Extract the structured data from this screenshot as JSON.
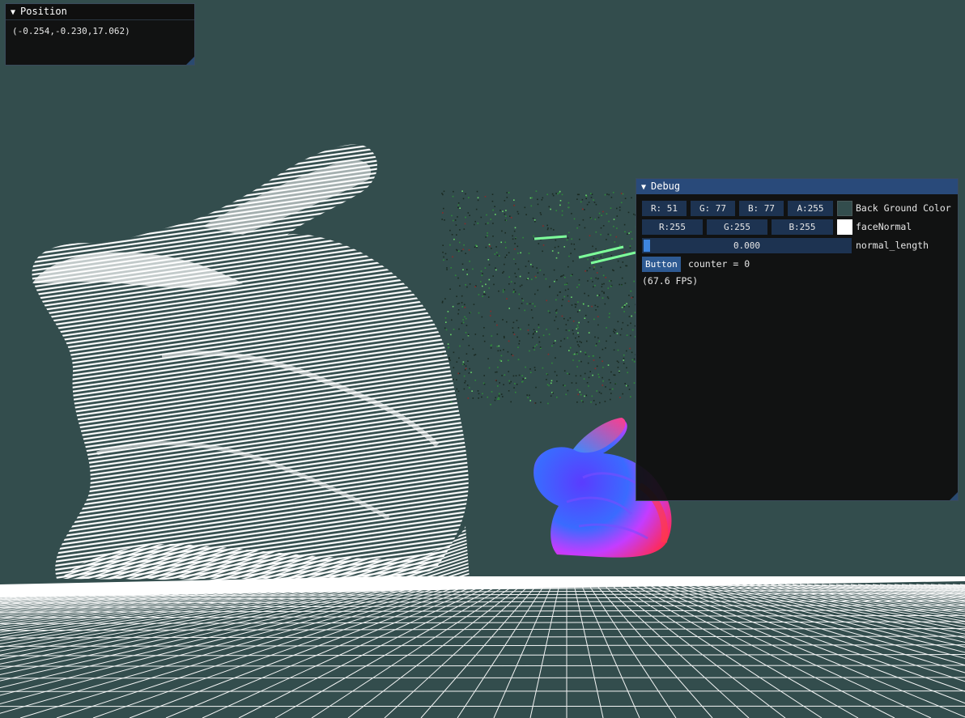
{
  "colors": {
    "background": "#334d4d",
    "window_bg": "#0f0f0f",
    "title_active": "#294a7a",
    "frame_bg": "#1d3351",
    "button": "#2e5a92",
    "slider_grab": "#3d85e0",
    "point_cloud": "#ffffff"
  },
  "scene": {
    "large_bunny": "white point-cloud bunny",
    "small_bunny": "normal-shaded bunny",
    "floor": "grid floor"
  },
  "position_window": {
    "title": "Position",
    "value": "(-0.254,-0.230,17.062)"
  },
  "debug_window": {
    "title": "Debug",
    "bg_color": {
      "r": "R: 51",
      "g": "G: 77",
      "b": "B: 77",
      "a": "A:255",
      "swatch": "#334d4d",
      "label": "Back Ground Color"
    },
    "face_normal": {
      "r": "R:255",
      "g": "G:255",
      "b": "B:255",
      "swatch": "#ffffff",
      "label": "faceNormal"
    },
    "normal_length": {
      "value": "0.000",
      "label": "normal_length"
    },
    "button_label": "Button",
    "counter_text": "counter = 0",
    "fps_text": "(67.6 FPS)"
  }
}
